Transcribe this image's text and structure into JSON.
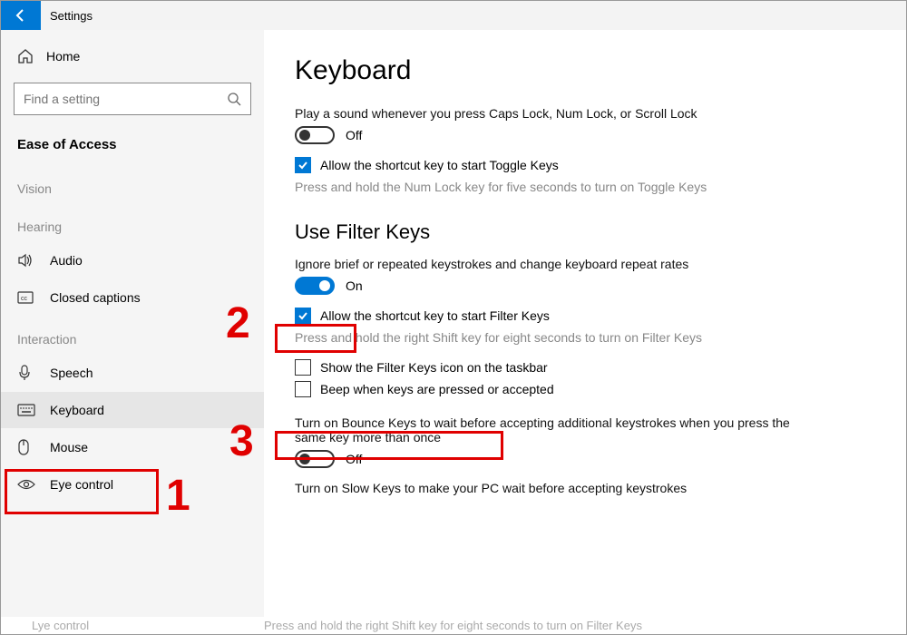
{
  "titlebar": {
    "title": "Settings"
  },
  "sidebar": {
    "home": "Home",
    "search_placeholder": "Find a setting",
    "category": "Ease of Access",
    "groups": {
      "vision": "Vision",
      "hearing": "Hearing",
      "interaction": "Interaction"
    },
    "items": {
      "audio": "Audio",
      "closed_captions": "Closed captions",
      "speech": "Speech",
      "keyboard": "Keyboard",
      "mouse": "Mouse",
      "eye_control": "Eye control"
    }
  },
  "page": {
    "title": "Keyboard",
    "sound_desc": "Play a sound whenever you press Caps Lock, Num Lock, or Scroll Lock",
    "sound_state": "Off",
    "toggle_keys_checkbox": "Allow the shortcut key to start Toggle Keys",
    "toggle_keys_hint": "Press and hold the Num Lock key for five seconds to turn on Toggle Keys",
    "filter_title": "Use Filter Keys",
    "filter_desc": "Ignore brief or repeated keystrokes and change keyboard repeat rates",
    "filter_state": "On",
    "filter_shortcut_checkbox": "Allow the shortcut key to start Filter Keys",
    "filter_shortcut_hint": "Press and hold the right Shift key for eight seconds to turn on Filter Keys",
    "show_icon_checkbox": "Show the Filter Keys icon on the taskbar",
    "beep_checkbox": "Beep when keys are pressed or accepted",
    "bounce_desc": "Turn on Bounce Keys to wait before accepting additional keystrokes when you press the same key more than once",
    "bounce_state": "Off",
    "slow_desc": "Turn on Slow Keys to make your PC wait before accepting keystrokes"
  },
  "annotations": {
    "n1": "1",
    "n2": "2",
    "n3": "3"
  },
  "truncated": {
    "left": "Lye control",
    "right": "Press and hold the right Shift key for eight seconds to turn on Filter Keys"
  }
}
